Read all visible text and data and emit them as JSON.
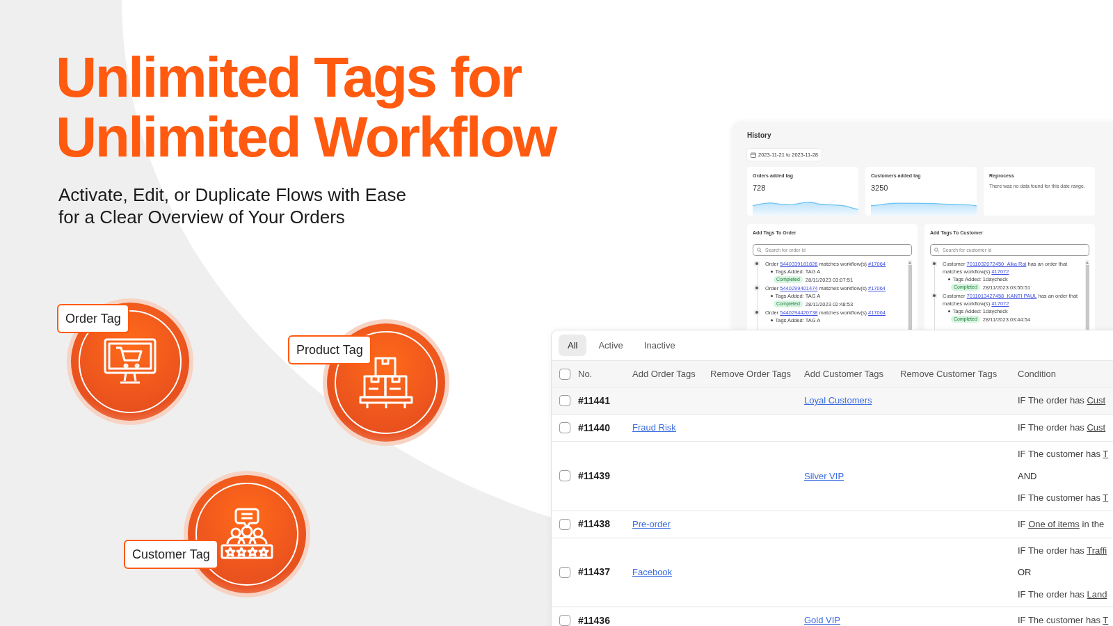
{
  "headline": {
    "lines": [
      "Unlimited Tags for",
      "Unlimited Workflow"
    ]
  },
  "subtitle": {
    "lines": [
      "Activate, Edit, or Duplicate Flows with Ease",
      "for a Clear Overview of Your Orders"
    ]
  },
  "features": [
    {
      "kind": "order",
      "label": "Order Tag"
    },
    {
      "kind": "product",
      "label": "Product Tag"
    },
    {
      "kind": "customer",
      "label": "Customer Tag"
    }
  ],
  "history": {
    "title": "History",
    "date_range": "2023-11-21 to 2023-11-28",
    "stats": [
      {
        "kind": "sparkline",
        "label": "Orders added tag",
        "value": "728"
      },
      {
        "kind": "sparkline",
        "label": "Customers added tag",
        "value": "3250"
      },
      {
        "kind": "message",
        "label": "Reprocess",
        "message": "There was no data found for this date range."
      }
    ],
    "panels": [
      {
        "title": "Add Tags To Order",
        "placeholder": "Search for order id",
        "entries": [
          {
            "prefix": "Order ",
            "id": "5440339181826",
            "middle": " matches workflow(s) ",
            "workflow": "#17064",
            "tags": "Tags Added: TAG A",
            "status": "Completed",
            "time": "28/11/2023 03:07:51"
          },
          {
            "prefix": "Order ",
            "id": "5440299401474",
            "middle": " matches workflow(s) ",
            "workflow": "#17064",
            "tags": "Tags Added: TAG A",
            "status": "Completed",
            "time": "28/11/2023 02:48:53"
          },
          {
            "prefix": "Order ",
            "id": "5440294420738",
            "middle": " matches workflow(s) ",
            "workflow": "#17064",
            "tags": "Tags Added: TAG A"
          }
        ]
      },
      {
        "title": "Add Tags To Customer",
        "placeholder": "Search for customer id",
        "entries": [
          {
            "prefix": "Customer ",
            "id": "7011032072450_Alka Rai",
            "middle": " has an order that matches workflow(s) ",
            "workflow": "#17072",
            "tags": "Tags Added: 1daycheck",
            "status": "Completed",
            "time": "28/11/2023 03:55:51"
          },
          {
            "prefix": "Customer ",
            "id": "7011013427458_KANTI PAUL",
            "middle": " has an order that matches workflow(s) ",
            "workflow": "#17072",
            "tags": "Tags Added: 1daycheck",
            "status": "Completed",
            "time": "28/11/2023 03:44:54"
          }
        ]
      }
    ]
  },
  "workflows": {
    "tabs": [
      {
        "label": "All",
        "selected": true
      },
      {
        "label": "Active",
        "selected": false
      },
      {
        "label": "Inactive",
        "selected": false
      }
    ],
    "select_all_checked": false,
    "columns": [
      "No.",
      "Add Order Tags",
      "Remove Order Tags",
      "Add Customer Tags",
      "Remove Customer Tags",
      "Condition"
    ],
    "rows": [
      {
        "no": "#11441",
        "checked": false,
        "add_customer_tags": "Loyal Customers",
        "condition": [
          {
            "kind": "rule",
            "text": "IF The order has ",
            "link": "Cust"
          }
        ]
      },
      {
        "no": "#11440",
        "checked": false,
        "add_order_tags": "Fraud Risk",
        "condition": [
          {
            "kind": "rule",
            "text": "IF The order has ",
            "link": "Cust"
          }
        ]
      },
      {
        "no": "#11439",
        "checked": false,
        "add_customer_tags": "Silver VIP",
        "condition": [
          {
            "kind": "rule",
            "text": "IF The customer has ",
            "link": "T"
          },
          {
            "kind": "connector",
            "text": "AND"
          },
          {
            "kind": "rule",
            "text": "IF The customer has ",
            "link": "T"
          }
        ]
      },
      {
        "no": "#11438",
        "checked": false,
        "add_order_tags": "Pre-order",
        "condition": [
          {
            "kind": "rule",
            "text": "IF ",
            "link": "One of items",
            "after": " in the"
          }
        ]
      },
      {
        "no": "#11437",
        "checked": false,
        "add_order_tags": "Facebook",
        "condition": [
          {
            "kind": "rule",
            "text": "IF The order has ",
            "link": "Traffi"
          },
          {
            "kind": "connector",
            "text": "OR"
          },
          {
            "kind": "rule",
            "text": "IF The order has ",
            "link": "Land"
          }
        ]
      },
      {
        "no": "#11436",
        "checked": false,
        "add_customer_tags": "Gold VIP",
        "condition": [
          {
            "kind": "rule",
            "text": "IF The customer has ",
            "link": "T"
          }
        ]
      }
    ]
  }
}
